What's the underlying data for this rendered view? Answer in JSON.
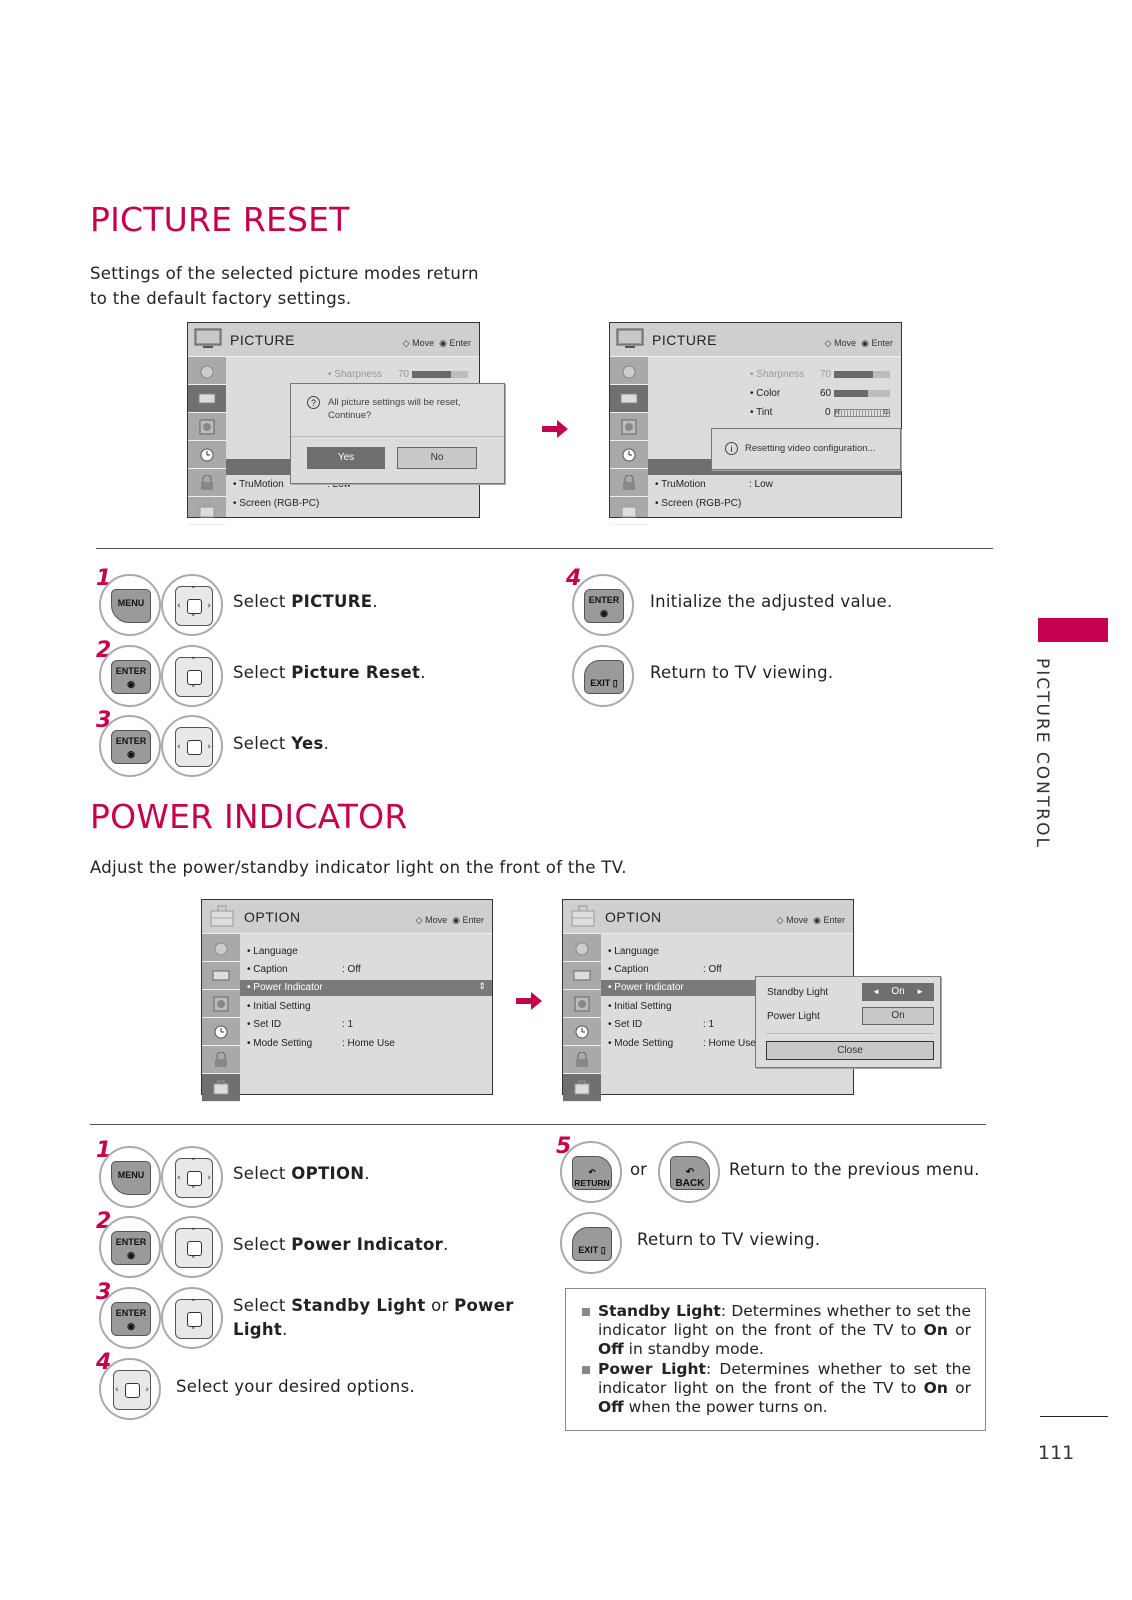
{
  "colors": {
    "accent": "#c5004e",
    "tv_bg": "#dcdcdc",
    "highlight": "#7a7a7a"
  },
  "picture_reset": {
    "title": "PICTURE RESET",
    "intro_line1": "Settings of the selected picture modes return",
    "intro_line2": "to the default factory settings.",
    "screen1": {
      "title": "PICTURE",
      "hint_move": "Move",
      "hint_enter": "Enter",
      "sharpness_label": "• Sharpness",
      "sharpness_value": "70",
      "sharpness_fraction": 0.7,
      "dialog_text_line1": "All picture settings will be reset,",
      "dialog_text_line2": "Continue?",
      "yes_label": "Yes",
      "no_label": "No",
      "trumotion_label": "• TruMotion",
      "trumotion_value": ": Low",
      "screen_label": "• Screen (RGB-PC)"
    },
    "screen2": {
      "title": "PICTURE",
      "hint_move": "Move",
      "hint_enter": "Enter",
      "sharpness_label": "• Sharpness",
      "sharpness_value": "70",
      "sharpness_fraction": 0.7,
      "color_label": "• Color",
      "color_value": "60",
      "color_fraction": 0.6,
      "tint_label": "• Tint",
      "tint_value": "0",
      "tint_left": "R",
      "tint_right": "G",
      "message": "Resetting video configuration...",
      "trumotion_label": "• TruMotion",
      "trumotion_value": ": Low",
      "screen_label": "• Screen (RGB-PC)"
    },
    "steps": [
      {
        "num": "1",
        "keys": [
          "MENU",
          "dpad-4way"
        ],
        "text": "Select ",
        "bold": "PICTURE",
        "after": "."
      },
      {
        "num": "2",
        "keys": [
          "ENTER",
          "dpad-updown"
        ],
        "text": "Select ",
        "bold": "Picture Reset",
        "after": "."
      },
      {
        "num": "3",
        "keys": [
          "ENTER",
          "dpad-leftright"
        ],
        "text": "Select ",
        "bold": "Yes",
        "after": "."
      },
      {
        "num": "4",
        "keys": [
          "ENTER"
        ],
        "text": "Initialize the adjusted value."
      },
      {
        "num": "",
        "keys": [
          "EXIT"
        ],
        "text": "Return to TV viewing."
      }
    ]
  },
  "power_indicator": {
    "title": "POWER INDICATOR",
    "intro": "Adjust the power/standby indicator light on the front of the TV.",
    "screen1": {
      "title": "OPTION",
      "hint_move": "Move",
      "hint_enter": "Enter",
      "items": [
        {
          "label": "• Language",
          "value": ""
        },
        {
          "label": "• Caption",
          "value": ": Off"
        },
        {
          "label": "• Power Indicator",
          "value": "",
          "selected": true
        },
        {
          "label": "• Initial Setting",
          "value": ""
        },
        {
          "label": "• Set ID",
          "value": ": 1"
        },
        {
          "label": "• Mode Setting",
          "value": ": Home Use"
        }
      ]
    },
    "screen2": {
      "title": "OPTION",
      "hint_move": "Move",
      "hint_enter": "Enter",
      "items": [
        {
          "label": "• Language",
          "value": ""
        },
        {
          "label": "• Caption",
          "value": ": Off"
        },
        {
          "label": "• Power Indicator",
          "value": "",
          "selected": true
        },
        {
          "label": "• Initial Setting",
          "value": ""
        },
        {
          "label": "• Set ID",
          "value": ": 1"
        },
        {
          "label": "• Mode Setting",
          "value": ": Home Use"
        }
      ],
      "popup": {
        "standby_label": "Standby Light",
        "standby_value": "On",
        "power_label": "Power Light",
        "power_value": "On",
        "close_label": "Close"
      }
    },
    "steps": [
      {
        "num": "1",
        "keys": [
          "MENU",
          "dpad-4way"
        ],
        "text": "Select ",
        "bold": "OPTION",
        "after": "."
      },
      {
        "num": "2",
        "keys": [
          "ENTER",
          "dpad-updown"
        ],
        "text": "Select ",
        "bold": "Power Indicator",
        "after": "."
      },
      {
        "num": "3",
        "keys": [
          "ENTER",
          "dpad-updown"
        ],
        "text": "Select ",
        "bold": "Standby Light",
        "mid": " or ",
        "bold2": "Power",
        "line2_bold": "Light",
        "after": "."
      },
      {
        "num": "4",
        "keys": [
          "dpad-leftright"
        ],
        "text": "Select your desired options."
      },
      {
        "num": "5",
        "keys": [
          "RETURN",
          "BACK"
        ],
        "or": "or",
        "text": "Return to the previous menu."
      },
      {
        "num": "",
        "keys": [
          "EXIT"
        ],
        "text": "Return to TV viewing."
      }
    ],
    "notes": [
      {
        "bold": "Standby Light",
        "text": ": Determines whether to set the indicator light on the front of the TV to ",
        "b1": "On",
        "mid": " or ",
        "b2": "Off",
        "end": " in standby mode."
      },
      {
        "bold": "Power Light",
        "text": ": Determines whether to set the indicator light on the front of the TV to ",
        "b1": "On",
        "mid": " or ",
        "b2": "Off",
        "end": " when the power turns on."
      }
    ]
  },
  "keys": {
    "menu": "MENU",
    "enter": "ENTER",
    "exit": "EXIT",
    "return": "RETURN",
    "back": "BACK"
  },
  "side_tab": {
    "label": "PICTURE CONTROL"
  },
  "page_number": "111"
}
